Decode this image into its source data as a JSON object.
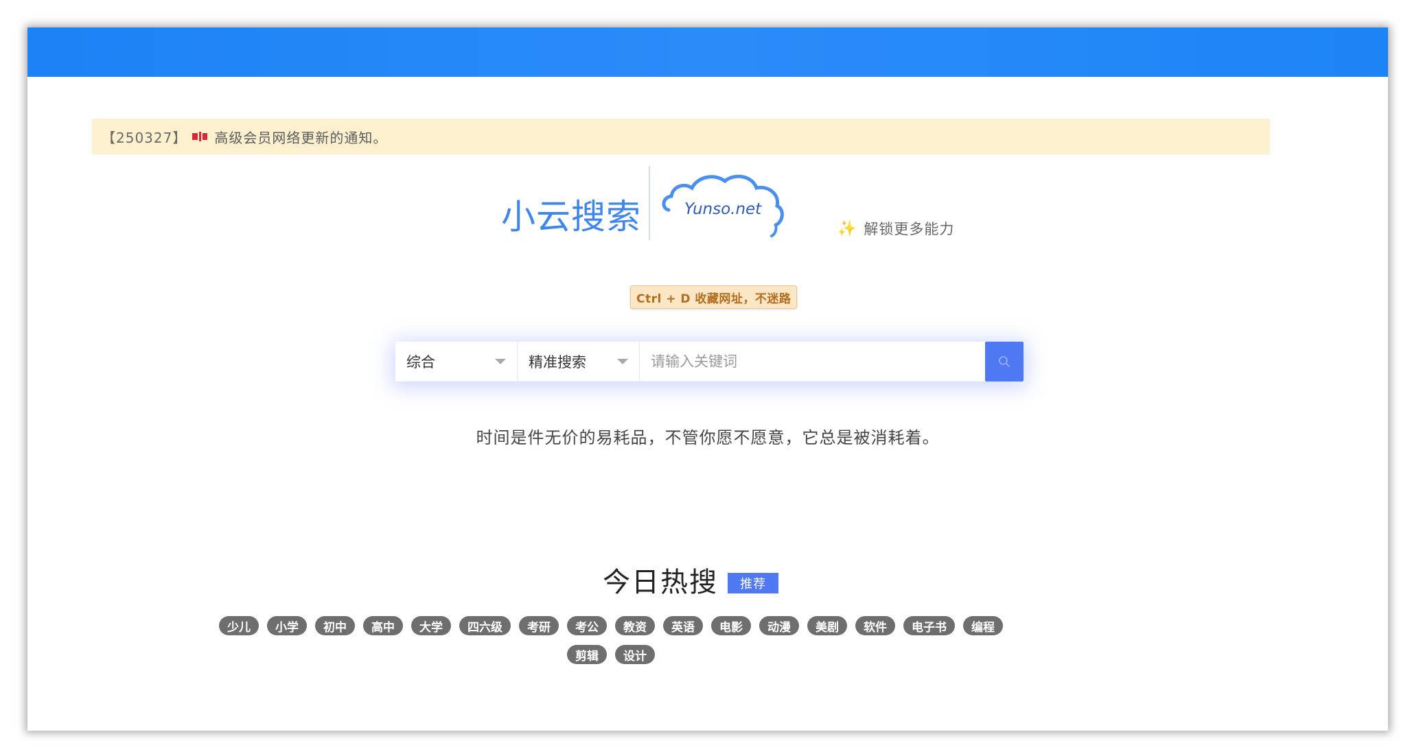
{
  "notice": {
    "date": "【250327】",
    "text": "高级会员网络更新的通知。",
    "flag_icon": "red-flag-icon"
  },
  "brand": {
    "name": "小云搜索",
    "logo_text": "Yunso.net",
    "logo_icon": "cloud-logo-icon"
  },
  "unlock": {
    "icon": "sparkle-icon",
    "label": "解锁更多能力"
  },
  "bookmark_tip": "Ctrl + D 收藏网址，不迷路",
  "search": {
    "category_selected": "综合",
    "mode_selected": "精准搜索",
    "placeholder": "请输入关键词",
    "value": "",
    "button_icon": "search-icon"
  },
  "quote": "时间是件无价的易耗品，不管你愿不愿意，它总是被消耗着。",
  "hot": {
    "title": "今日热搜",
    "badge": "推荐",
    "tags": [
      "少儿",
      "小学",
      "初中",
      "高中",
      "大学",
      "四六级",
      "考研",
      "考公",
      "教资",
      "英语",
      "电影",
      "动漫",
      "美剧",
      "软件",
      "电子书",
      "编程",
      "剪辑",
      "设计"
    ]
  },
  "colors": {
    "topbar": "#1c82f5",
    "accent": "#4f78f3",
    "notice_bg": "#fdf0cf",
    "tag_bg": "#6e6e6e"
  }
}
